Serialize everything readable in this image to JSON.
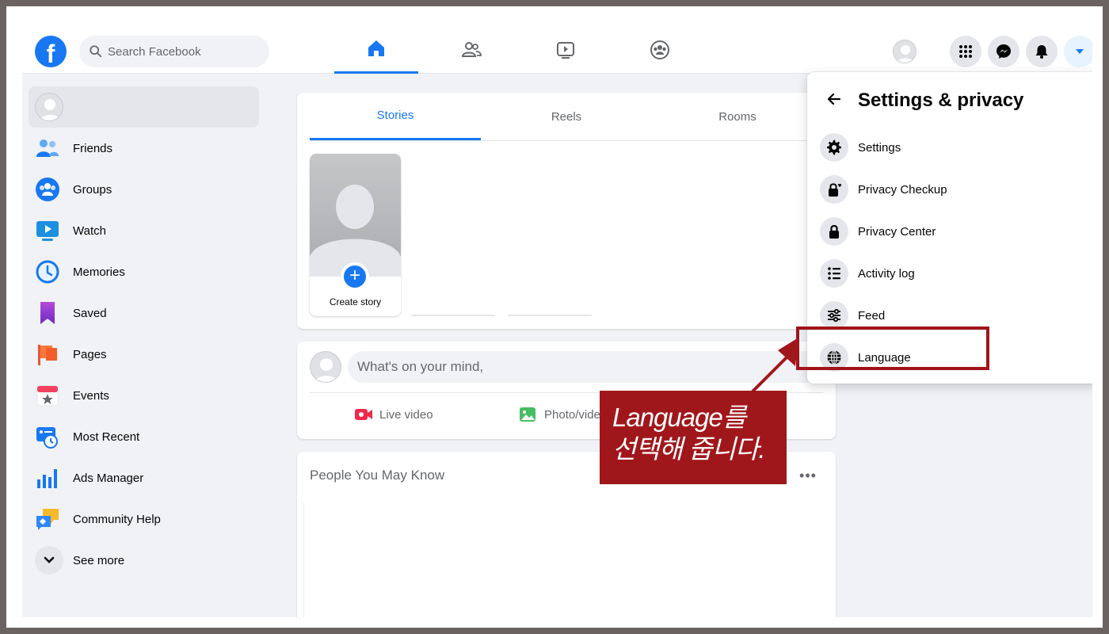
{
  "search": {
    "placeholder": "Search Facebook"
  },
  "brand": {
    "logo_letter": "f",
    "accent": "#1877f2"
  },
  "topnav": {
    "tabs": [
      {
        "id": "home",
        "icon": "home-icon",
        "active": true
      },
      {
        "id": "friends",
        "icon": "friends-icon",
        "active": false
      },
      {
        "id": "watch",
        "icon": "watch-icon",
        "active": false
      },
      {
        "id": "groups",
        "icon": "groups-icon",
        "active": false
      }
    ],
    "right_buttons": [
      "menu-grid-icon",
      "messenger-icon",
      "notifications-bell-icon",
      "account-caret-icon"
    ]
  },
  "sidebar": {
    "items": [
      {
        "label": "Friends",
        "icon": "friends-icon"
      },
      {
        "label": "Groups",
        "icon": "groups-icon"
      },
      {
        "label": "Watch",
        "icon": "watch-icon"
      },
      {
        "label": "Memories",
        "icon": "memories-icon"
      },
      {
        "label": "Saved",
        "icon": "saved-icon"
      },
      {
        "label": "Pages",
        "icon": "pages-icon"
      },
      {
        "label": "Events",
        "icon": "events-icon"
      },
      {
        "label": "Most Recent",
        "icon": "most-recent-icon"
      },
      {
        "label": "Ads Manager",
        "icon": "ads-manager-icon"
      },
      {
        "label": "Community Help",
        "icon": "community-help-icon"
      },
      {
        "label": "See more",
        "icon": "chevron-down-icon"
      }
    ]
  },
  "stories": {
    "tabs": [
      {
        "label": "Stories",
        "active": true
      },
      {
        "label": "Reels",
        "active": false
      },
      {
        "label": "Rooms",
        "active": false
      }
    ],
    "create_label": "Create story"
  },
  "composer": {
    "placeholder": "What's on your mind,",
    "actions": [
      {
        "label": "Live video",
        "icon": "live-video-icon"
      },
      {
        "label": "Photo/video",
        "icon": "photo-video-icon"
      }
    ]
  },
  "pymk": {
    "title": "People You May Know",
    "more": "•••"
  },
  "settings_menu": {
    "title": "Settings & privacy",
    "items": [
      {
        "label": "Settings",
        "icon": "gear-icon"
      },
      {
        "label": "Privacy Checkup",
        "icon": "privacy-checkup-icon"
      },
      {
        "label": "Privacy Center",
        "icon": "lock-icon"
      },
      {
        "label": "Activity log",
        "icon": "activity-log-icon"
      },
      {
        "label": "Feed",
        "icon": "feed-sliders-icon"
      },
      {
        "label": "Language",
        "icon": "globe-icon"
      }
    ]
  },
  "annotation": {
    "line1": "Language를",
    "line2": "선택해 줍니다.",
    "color": "#a0171b"
  }
}
